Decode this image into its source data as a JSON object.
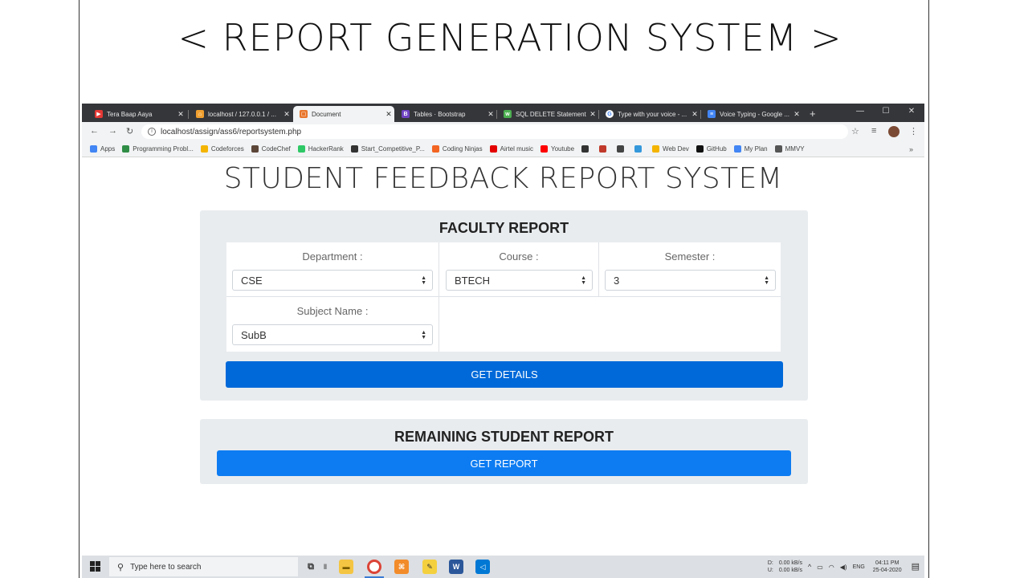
{
  "slide": {
    "title": "< REPORT GENERATION SYSTEM >"
  },
  "browser": {
    "tabs": [
      {
        "label": "Tera Baap Aaya",
        "icon": "youtube-icon",
        "color": "#e53935"
      },
      {
        "label": "localhost / 127.0.0.1 / ...",
        "icon": "phpmyadmin-icon",
        "color": "#f0a030"
      },
      {
        "label": "Document",
        "icon": "html-file-icon",
        "color": "#e8762c"
      },
      {
        "label": "Tables · Bootstrap",
        "icon": "bootstrap-icon",
        "color": "#6f42c1"
      },
      {
        "label": "SQL DELETE Statement",
        "icon": "w3schools-icon",
        "color": "#4caf50"
      },
      {
        "label": "Type with your voice - ...",
        "icon": "google-icon",
        "color": "#ffffff"
      },
      {
        "label": "Voice Typing - Google ...",
        "icon": "google-docs-icon",
        "color": "#4285f4"
      }
    ],
    "url": "localhost/assign/ass6/reportsystem.php",
    "bookmarks": [
      {
        "label": "Apps",
        "icon": "apps-grid-icon",
        "color": "#4285f4"
      },
      {
        "label": "Programming Probl...",
        "icon": "gfg-icon",
        "color": "#2f8d46"
      },
      {
        "label": "Codeforces",
        "icon": "codeforces-icon",
        "color": "#f4b400"
      },
      {
        "label": "CodeChef",
        "icon": "codechef-icon",
        "color": "#5b4638"
      },
      {
        "label": "HackerRank",
        "icon": "hackerrank-icon",
        "color": "#2ec866"
      },
      {
        "label": "Start_Competitive_P...",
        "icon": "hashnode-icon",
        "color": "#333333"
      },
      {
        "label": "Coding Ninjas",
        "icon": "coding-ninjas-icon",
        "color": "#f26522"
      },
      {
        "label": "Airtel music",
        "icon": "airtel-icon",
        "color": "#e40000"
      },
      {
        "label": "Youtube",
        "icon": "youtube-icon",
        "color": "#ff0000"
      },
      {
        "label": "",
        "icon": "h-bookmark-icon",
        "color": "#333333"
      },
      {
        "label": "",
        "icon": "c-bookmark-icon",
        "color": "#c0392b"
      },
      {
        "label": "",
        "icon": "s-bookmark-icon",
        "color": "#444444"
      },
      {
        "label": "",
        "icon": "beta-bookmark-icon",
        "color": "#3498db"
      },
      {
        "label": "Web Dev",
        "icon": "folder-icon",
        "color": "#f4b400"
      },
      {
        "label": "GitHub",
        "icon": "github-icon",
        "color": "#111111"
      },
      {
        "label": "My Plan",
        "icon": "google-icon",
        "color": "#4285f4"
      },
      {
        "label": "MMVY",
        "icon": "globe-icon",
        "color": "#555555"
      }
    ],
    "bookmarks_more": "»"
  },
  "page": {
    "heading": "STUDENT FEEDBACK REPORT SYSTEM",
    "faculty": {
      "title": "FACULTY REPORT",
      "department_label": "Department :",
      "department_value": "CSE",
      "course_label": "Course :",
      "course_value": "BTECH",
      "semester_label": "Semester :",
      "semester_value": "3",
      "subject_label": "Subject Name :",
      "subject_value": "SubB",
      "button": "GET DETAILS"
    },
    "remaining": {
      "title": "REMAINING STUDENT REPORT",
      "button": "GET REPORT"
    }
  },
  "taskbar": {
    "search_placeholder": "Type here to search",
    "net_d": "0.00 kB/s",
    "net_u": "0.00 kB/s",
    "net_d_label": "D:",
    "net_u_label": "U:",
    "lang": "ENG",
    "time": "04:11 PM",
    "date": "25-04-2020"
  }
}
